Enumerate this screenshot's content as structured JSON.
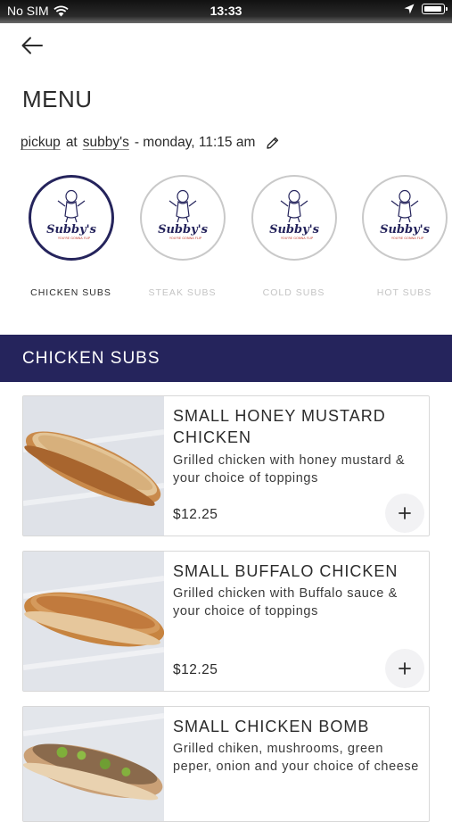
{
  "status_bar": {
    "carrier": "No SIM",
    "time": "13:33"
  },
  "header": {
    "title": "MENU"
  },
  "order_info": {
    "mode": "pickup",
    "at_text": "at",
    "location": "subby's",
    "schedule": "- monday, 11:15 am"
  },
  "categories": [
    {
      "label": "CHICKEN SUBS",
      "logo_text": "Subby's",
      "tagline": "YOU'RE GONNA FLIP",
      "active": true
    },
    {
      "label": "STEAK SUBS",
      "logo_text": "Subby's",
      "tagline": "YOU'RE GONNA FLIP",
      "active": false
    },
    {
      "label": "COLD SUBS",
      "logo_text": "Subby's",
      "tagline": "YOU'RE GONNA FLIP",
      "active": false
    },
    {
      "label": "HOT SUBS",
      "logo_text": "Subby's",
      "tagline": "YOU'RE GONNA FLIP",
      "active": false
    }
  ],
  "section": {
    "title": "CHICKEN SUBS"
  },
  "items": [
    {
      "name": "SMALL HONEY MUSTARD CHICKEN",
      "description": "Grilled chicken with honey mustard & your choice of toppings",
      "price": "$12.25"
    },
    {
      "name": "SMALL BUFFALO CHICKEN",
      "description": "Grilled chicken with Buffalo sauce & your choice of toppings",
      "price": "$12.25"
    },
    {
      "name": "SMALL CHICKEN BOMB",
      "description": "Grilled chiken, mushrooms, green peper, onion and your choice of cheese",
      "price": ""
    }
  ],
  "colors": {
    "brand_navy": "#25245c",
    "inactive_border": "#c9c9c9",
    "inactive_label": "#c4c4c4"
  },
  "icons": [
    "wifi-icon",
    "location-arrow-icon",
    "battery-icon",
    "back-arrow-icon",
    "pencil-icon",
    "plus-icon"
  ]
}
